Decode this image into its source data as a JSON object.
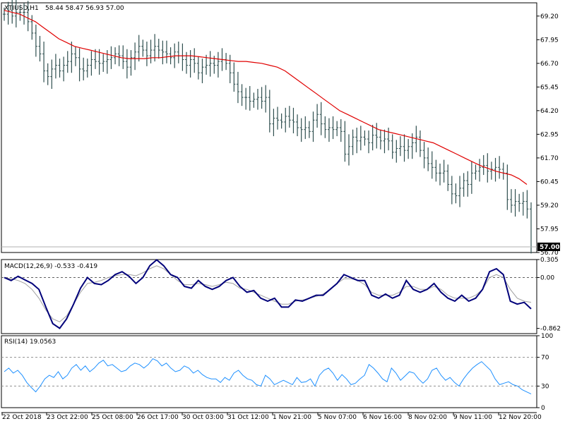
{
  "header": {
    "symbol": "XTIUSD,H1",
    "ohlc": "58.44 58.47 56.93 57.00"
  },
  "colors": {
    "background": "#ffffff",
    "grid": "#c0c0c0",
    "price_bars": "#2f4f4f",
    "moving_average": "#e00000",
    "macd_line": "#00007a",
    "signal_line": "#a0a0a0",
    "rsi_line": "#1e90ff",
    "last_price_box": "#000000",
    "last_price_text": "#ffffff"
  },
  "price_panel": {
    "y_ticks": [
      "69.20",
      "67.95",
      "66.70",
      "65.45",
      "64.20",
      "62.95",
      "61.70",
      "60.45",
      "59.20",
      "57.95",
      "56.70"
    ],
    "last_price_label": "57.00"
  },
  "macd_panel": {
    "label": "MACD(12,26,9) -0.533 -0.419",
    "y_ticks": [
      "0.305",
      "0.00",
      "-0.862"
    ]
  },
  "rsi_panel": {
    "label": "RSI(14) 19.0563",
    "y_ticks": [
      "100",
      "70",
      "30",
      "0"
    ]
  },
  "x_axis": {
    "labels": [
      "22 Oct 2018",
      "23 Oct 22:00",
      "25 Oct 08:00",
      "26 Oct 17:00",
      "30 Oct 03:00",
      "31 Oct 12:00",
      "1 Nov 21:00",
      "5 Nov 07:00",
      "6 Nov 16:00",
      "8 Nov 02:00",
      "9 Nov 11:00",
      "12 Nov 20:00"
    ]
  },
  "chart_data": [
    {
      "type": "ohlc",
      "title": "XTIUSD,H1",
      "series": [
        {
          "name": "Price",
          "values": [
            69.3,
            69.5,
            69.2,
            69.4,
            69.4,
            69.4,
            68.9,
            68.3,
            67.6,
            67.2,
            66.3,
            66.0,
            66.4,
            66.6,
            66.3,
            66.6,
            66.8,
            67.2,
            67.0,
            66.4,
            66.3,
            66.6,
            66.9,
            66.8,
            66.7,
            66.8,
            66.9,
            67.0,
            67.2,
            67.1,
            66.8,
            66.5,
            67.0,
            67.3,
            67.6,
            67.4,
            67.1,
            67.4,
            67.6,
            67.4,
            67.3,
            67.2,
            67.0,
            67.3,
            67.1,
            66.9,
            66.6,
            66.9,
            66.7,
            66.2,
            66.5,
            66.6,
            66.7,
            66.6,
            66.8,
            66.9,
            66.7,
            66.2,
            65.6,
            65.2,
            64.9,
            64.9,
            64.7,
            64.8,
            64.9,
            64.7,
            64.9,
            63.5,
            63.8,
            63.7,
            63.6,
            63.9,
            63.7,
            63.6,
            63.3,
            63.2,
            63.3,
            63.1,
            63.7,
            64.0,
            63.5,
            63.2,
            63.3,
            63.2,
            63.3,
            63.1,
            61.9,
            62.3,
            62.8,
            62.6,
            62.8,
            62.7,
            62.5,
            62.9,
            62.8,
            62.6,
            62.7,
            62.6,
            62.0,
            62.2,
            62.3,
            62.1,
            62.3,
            62.5,
            62.8,
            62.1,
            61.7,
            61.4,
            61.2,
            60.9,
            60.9,
            61.0,
            60.3,
            59.8,
            59.7,
            60.1,
            60.5,
            60.3,
            60.9,
            61.0,
            61.2,
            61.3,
            61.0,
            61.1,
            61.2,
            61.1,
            60.9,
            59.5,
            59.2,
            59.4,
            59.3,
            59.4,
            59.0,
            57.0
          ]
        },
        {
          "name": "MA",
          "values": [
            69.5,
            69.4,
            69.3,
            69.1,
            68.9,
            68.6,
            68.3,
            68.0,
            67.8,
            67.6,
            67.5,
            67.4,
            67.3,
            67.2,
            67.1,
            67.0,
            66.95,
            66.95,
            66.95,
            67.0,
            67.0,
            67.05,
            67.1,
            67.1,
            67.1,
            67.05,
            67.0,
            66.95,
            66.9,
            66.85,
            66.8,
            66.8,
            66.75,
            66.7,
            66.6,
            66.5,
            66.3,
            66.0,
            65.7,
            65.4,
            65.1,
            64.8,
            64.5,
            64.2,
            64.0,
            63.8,
            63.6,
            63.4,
            63.2,
            63.1,
            63.0,
            62.9,
            62.8,
            62.7,
            62.6,
            62.5,
            62.3,
            62.1,
            61.9,
            61.7,
            61.5,
            61.3,
            61.15,
            61.0,
            60.9,
            60.8,
            60.6,
            60.3
          ]
        }
      ],
      "ylim": [
        56.7,
        69.9
      ],
      "grid": false
    },
    {
      "type": "line",
      "title": "MACD(12,26,9)",
      "series": [
        {
          "name": "MACD",
          "values": [
            0.0,
            -0.05,
            0.02,
            -0.04,
            -0.1,
            -0.2,
            -0.5,
            -0.78,
            -0.86,
            -0.7,
            -0.45,
            -0.18,
            0.0,
            -0.1,
            -0.12,
            -0.05,
            0.05,
            0.1,
            0.02,
            -0.1,
            0.0,
            0.2,
            0.3,
            0.2,
            0.05,
            0.0,
            -0.15,
            -0.18,
            -0.05,
            -0.15,
            -0.2,
            -0.15,
            -0.05,
            0.0,
            -0.15,
            -0.25,
            -0.22,
            -0.35,
            -0.4,
            -0.35,
            -0.5,
            -0.5,
            -0.38,
            -0.4,
            -0.35,
            -0.3,
            -0.3,
            -0.2,
            -0.1,
            0.05,
            0.0,
            -0.05,
            -0.05,
            -0.3,
            -0.35,
            -0.28,
            -0.35,
            -0.3,
            -0.05,
            -0.2,
            -0.25,
            -0.2,
            -0.1,
            -0.25,
            -0.35,
            -0.4,
            -0.3,
            -0.4,
            -0.35,
            -0.2,
            0.1,
            0.15,
            0.05,
            -0.4,
            -0.45,
            -0.42,
            -0.53
          ]
        },
        {
          "name": "Signal",
          "values": [
            0.0,
            -0.02,
            -0.05,
            -0.1,
            -0.2,
            -0.35,
            -0.55,
            -0.7,
            -0.75,
            -0.65,
            -0.45,
            -0.25,
            -0.1,
            -0.08,
            -0.05,
            0.0,
            0.03,
            0.05,
            0.05,
            0.03,
            0.08,
            0.15,
            0.2,
            0.15,
            0.05,
            -0.05,
            -0.12,
            -0.12,
            -0.1,
            -0.12,
            -0.15,
            -0.12,
            -0.08,
            -0.1,
            -0.18,
            -0.2,
            -0.25,
            -0.3,
            -0.35,
            -0.4,
            -0.45,
            -0.45,
            -0.4,
            -0.38,
            -0.35,
            -0.32,
            -0.28,
            -0.2,
            -0.1,
            -0.02,
            -0.02,
            -0.05,
            -0.12,
            -0.25,
            -0.3,
            -0.3,
            -0.3,
            -0.25,
            -0.15,
            -0.15,
            -0.2,
            -0.2,
            -0.15,
            -0.2,
            -0.3,
            -0.35,
            -0.35,
            -0.35,
            -0.3,
            -0.2,
            0.0,
            0.05,
            0.0,
            -0.2,
            -0.35,
            -0.4,
            -0.419
          ]
        }
      ],
      "ylim": [
        -0.95,
        0.305
      ]
    },
    {
      "type": "line",
      "title": "RSI(14)",
      "series": [
        {
          "name": "RSI",
          "values": [
            50,
            55,
            48,
            52,
            45,
            35,
            28,
            22,
            30,
            40,
            45,
            42,
            50,
            40,
            45,
            55,
            60,
            52,
            58,
            50,
            55,
            62,
            66,
            58,
            60,
            55,
            50,
            52,
            58,
            62,
            60,
            55,
            60,
            68,
            65,
            58,
            62,
            55,
            50,
            52,
            58,
            55,
            48,
            52,
            46,
            42,
            40,
            40,
            35,
            42,
            38,
            48,
            52,
            45,
            40,
            38,
            32,
            30,
            45,
            40,
            32,
            35,
            38,
            35,
            32,
            42,
            35,
            36,
            40,
            30,
            45,
            52,
            55,
            48,
            38,
            46,
            40,
            32,
            34,
            40,
            45,
            60,
            55,
            48,
            40,
            36,
            55,
            48,
            38,
            44,
            50,
            48,
            40,
            34,
            40,
            52,
            55,
            45,
            38,
            42,
            35,
            30,
            40,
            48,
            55,
            60,
            64,
            58,
            52,
            40,
            32,
            34,
            36,
            32,
            30,
            25,
            22,
            19
          ]
        }
      ],
      "ylim": [
        0,
        100
      ],
      "levels": [
        70,
        30
      ]
    }
  ]
}
